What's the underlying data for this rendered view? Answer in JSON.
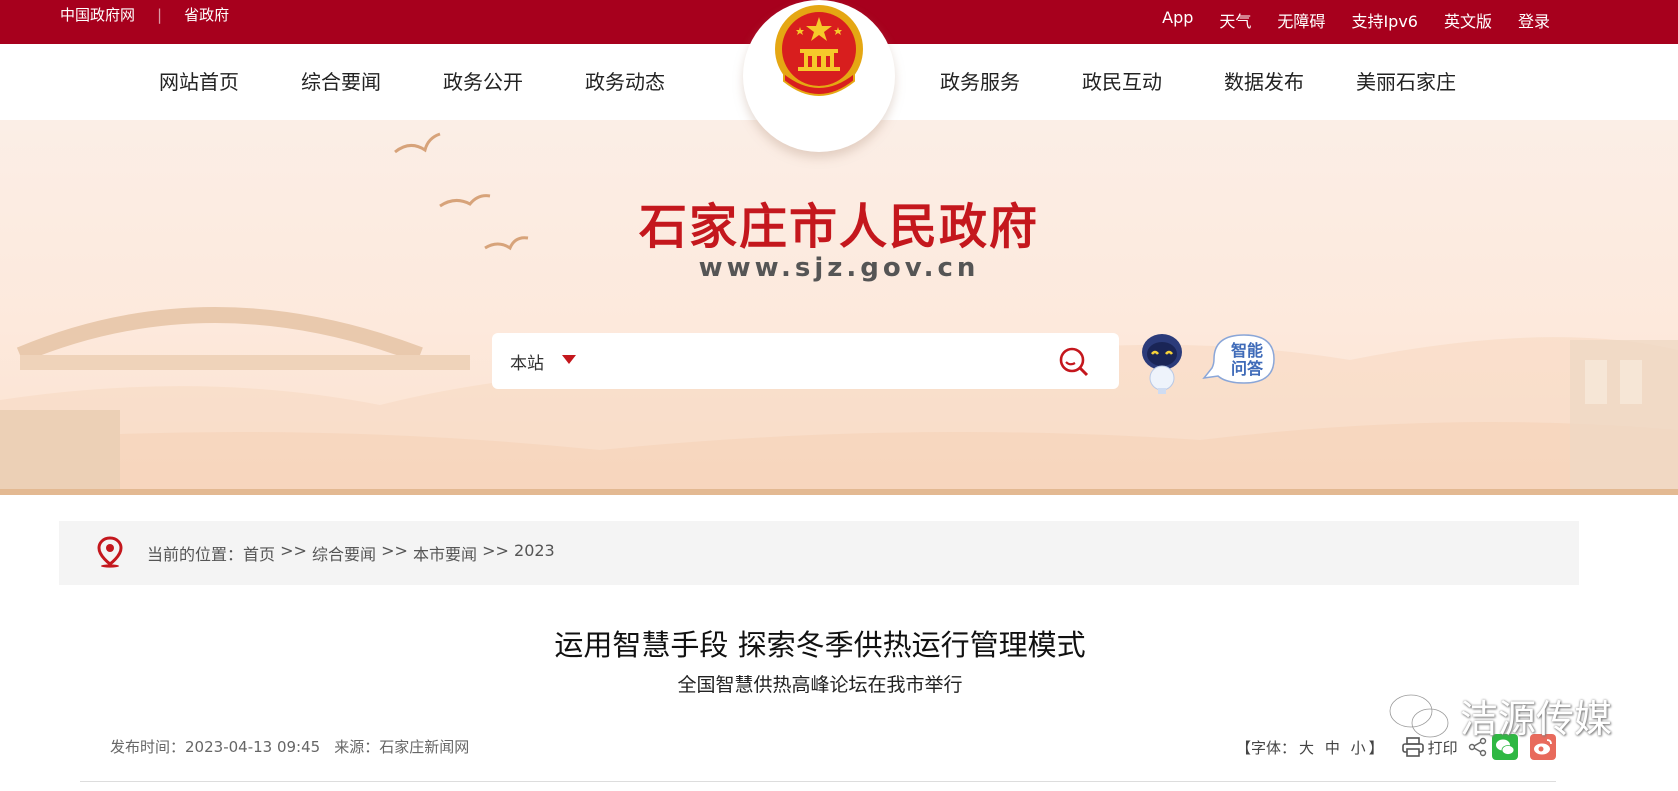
{
  "top_bar": {
    "left_links": [
      "中国政府网",
      "省政府"
    ],
    "separator": "|",
    "right_links": [
      "App",
      "天气",
      "无障碍",
      "支持Ipv6",
      "英文版",
      "登录"
    ]
  },
  "nav": {
    "items": [
      "网站首页",
      "综合要闻",
      "政务公开",
      "政务动态",
      "政务服务",
      "政民互动",
      "数据发布",
      "美丽石家庄"
    ]
  },
  "banner": {
    "title": "石家庄市人民政府",
    "url": "www.sjz.gov.cn"
  },
  "search": {
    "scope": "本站",
    "placeholder": "",
    "value": ""
  },
  "assistant": {
    "label_line1": "智能",
    "label_line2": "问答"
  },
  "breadcrumb": {
    "prefix": "当前的位置：",
    "items": [
      "首页",
      "综合要闻",
      "本市要闻",
      "2023"
    ],
    "separator": " >> "
  },
  "article": {
    "title": "运用智慧手段 探索冬季供热运行管理模式",
    "subtitle": "全国智慧供热高峰论坛在我市举行",
    "publish_time_label": "发布时间：",
    "publish_time": "2023-04-13 09:45",
    "source_label": "来源：",
    "source": "石家庄新闻网"
  },
  "tools": {
    "font_label_open": "【字体：",
    "font_sizes": [
      "大",
      "中",
      "小"
    ],
    "font_label_close": "】",
    "print_label": "打印"
  },
  "watermark": {
    "text": "洁源传媒"
  },
  "colors": {
    "brand_red": "#a7001d",
    "title_red": "#c4171d",
    "banner_bg": "#fbeee6",
    "wechat_green": "#2fb843",
    "weibo_red": "#e86a5c"
  }
}
